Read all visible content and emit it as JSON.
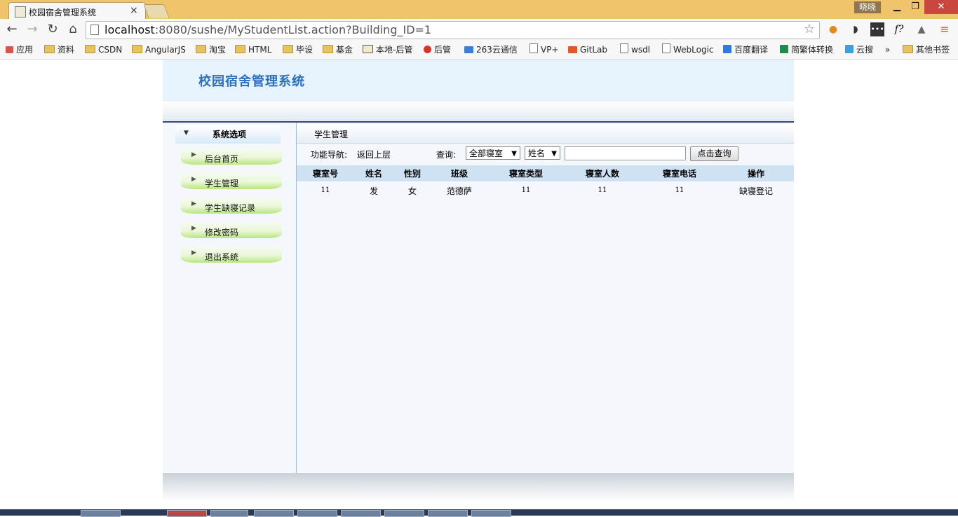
{
  "browser": {
    "tab_title": "校园宿舍管理系统",
    "tab_close": "×",
    "user_badge": "晓晓",
    "url_host": "localhost",
    "url_rest": ":8080/sushe/MyStudentList.action?Building_ID=1",
    "bookmarks": [
      "应用",
      "资料",
      "CSDN",
      "AngularJS",
      "淘宝",
      "HTML",
      "毕设",
      "基金",
      "本地-后管",
      "后管",
      "263云通信",
      "VP+",
      "GitLab",
      "wsdl",
      "WebLogic",
      "百度翻译",
      "简繁体转换",
      "云搜",
      "»",
      "其他书签"
    ]
  },
  "header": {
    "title": "校园宿舍管理系统"
  },
  "sidebar": {
    "title": "系统选项",
    "items": [
      {
        "label": "后台首页"
      },
      {
        "label": "学生管理"
      },
      {
        "label": "学生缺寝记录"
      },
      {
        "label": "修改密码"
      },
      {
        "label": "退出系统"
      }
    ]
  },
  "main": {
    "section_title": "学生管理",
    "nav_label": "功能导航:",
    "nav_link": "返回上层",
    "query_label": "查询:",
    "dorm_select": "全部寝室",
    "field_select": "姓名",
    "search_value": "",
    "search_button": "点击查询",
    "table": {
      "headers": [
        "寝室号",
        "姓名",
        "性别",
        "班级",
        "寝室类型",
        "寝室人数",
        "寝室电话",
        "操作"
      ],
      "rows": [
        [
          "11",
          "发",
          "女",
          "范德萨",
          "11",
          "11",
          "11",
          "缺寝登记"
        ]
      ]
    }
  },
  "colors": {
    "title_blue": "#2c6fbf",
    "header_bg": "#e6f3fc",
    "table_head_bg": "#cfe2f3",
    "menu_green": "#b9e67e"
  }
}
